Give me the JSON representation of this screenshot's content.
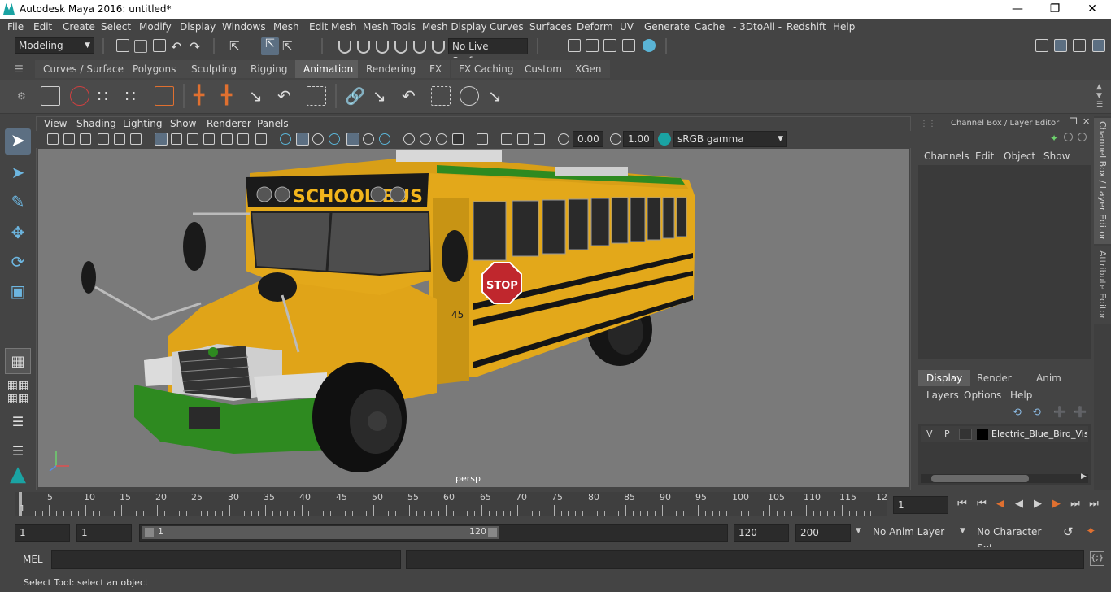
{
  "window": {
    "title": "Autodesk Maya 2016: untitled*"
  },
  "menu": [
    "File",
    "Edit",
    "Create",
    "Select",
    "Modify",
    "Display",
    "Windows",
    "Mesh",
    "Edit Mesh",
    "Mesh Tools",
    "Mesh Display",
    "Curves",
    "Surfaces",
    "Deform",
    "UV",
    "Generate",
    "Cache",
    "- 3DtoAll -",
    "Redshift",
    "Help"
  ],
  "status": {
    "mode": "Modeling",
    "live_surface": "No Live Surface"
  },
  "shelf_tabs": [
    "Curves / Surfaces",
    "Polygons",
    "Sculpting",
    "Rigging",
    "Animation",
    "Rendering",
    "FX",
    "FX Caching",
    "Custom",
    "XGen"
  ],
  "shelf_active": "Animation",
  "viewport": {
    "menu": [
      "View",
      "Shading",
      "Lighting",
      "Show",
      "Renderer",
      "Panels"
    ],
    "exposure": "0.00",
    "gamma": "1.00",
    "color_space": "sRGB gamma",
    "camera_label": "persp",
    "bus_sign": "SCHOOL BUS",
    "stop_sign": "STOP",
    "bus_number": "45"
  },
  "channel_box": {
    "title": "Channel Box / Layer Editor",
    "menu": [
      "Channels",
      "Edit",
      "Object",
      "Show"
    ],
    "layer_tabs": [
      "Display",
      "Render",
      "Anim"
    ],
    "layer_active": "Display",
    "layer_menu": [
      "Layers",
      "Options",
      "Help"
    ],
    "layer": {
      "v": "V",
      "p": "P",
      "name": "Electric_Blue_Bird_Visio"
    }
  },
  "side_tabs": [
    "Channel Box / Layer Editor",
    "Attribute Editor"
  ],
  "time": {
    "ticks": [
      "1",
      "5",
      "10",
      "15",
      "20",
      "25",
      "30",
      "35",
      "40",
      "45",
      "50",
      "55",
      "60",
      "65",
      "70",
      "75",
      "80",
      "85",
      "90",
      "95",
      "100",
      "105",
      "110",
      "115",
      "12"
    ],
    "current_frame": "1",
    "range_start": "1",
    "range_start2": "1",
    "slider_start": "1",
    "slider_end": "120",
    "end": "120",
    "anim_end": "200",
    "anim_layer": "No Anim Layer",
    "char_set": "No Character Set"
  },
  "command": {
    "label": "MEL"
  },
  "help": {
    "text": "Select Tool: select an object"
  },
  "colors": {
    "bus_yellow": "#e3a81a",
    "bus_green": "#2e8a20",
    "accent": "#5ab4d6"
  }
}
